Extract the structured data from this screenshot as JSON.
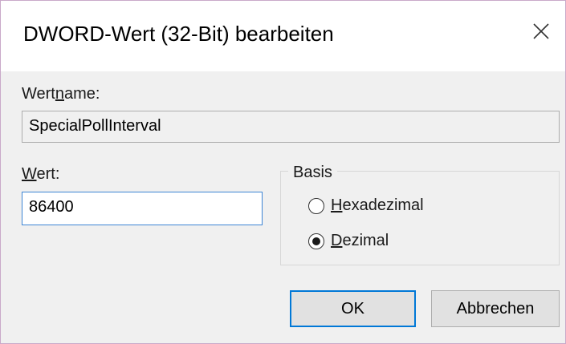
{
  "dialog": {
    "title": "DWORD-Wert (32-Bit) bearbeiten",
    "close_icon": "close-icon"
  },
  "value_name": {
    "label_pre": "Wert",
    "label_accel": "n",
    "label_post": "ame:",
    "value": "SpecialPollInterval"
  },
  "value_data": {
    "label_accel": "W",
    "label_post": "ert:",
    "value": "86400"
  },
  "base": {
    "title": "Basis",
    "options": [
      {
        "accel": "H",
        "rest": "exadezimal",
        "checked": false
      },
      {
        "accel": "D",
        "rest": "ezimal",
        "checked": true
      }
    ]
  },
  "buttons": {
    "ok": "OK",
    "cancel": "Abbrechen"
  }
}
